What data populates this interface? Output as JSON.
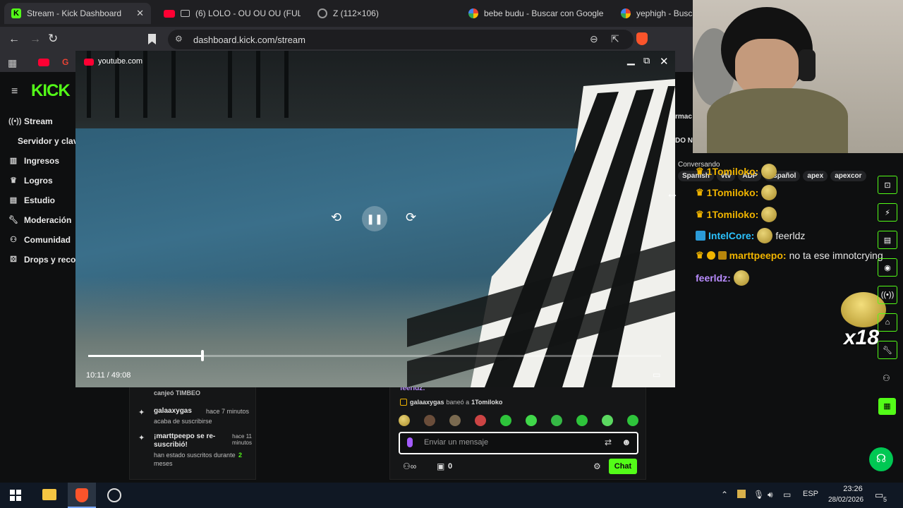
{
  "tabs": [
    {
      "label": "Stream - Kick Dashboard",
      "icon": "kick-logo-icon",
      "active": true
    },
    {
      "label": "(6) LOLO - OU OU OU (FULL A",
      "icon": "youtube-icon"
    },
    {
      "label": "Z (112×106)",
      "icon": "globe-icon"
    },
    {
      "label": "bebe budu - Buscar con Google",
      "icon": "google-icon"
    },
    {
      "label": "yephigh - Buscar",
      "icon": "google-icon"
    }
  ],
  "toolbar": {
    "url": "dashboard.kick.com/stream"
  },
  "pip": {
    "source": "youtube.com",
    "time": "10:11 / 49:08",
    "progress": 0.2
  },
  "sidebar": {
    "logo": "KICK",
    "items": [
      {
        "label": "Stream",
        "icon": "broadcast-icon"
      },
      {
        "label": "Servidor y clav",
        "icon": ""
      },
      {
        "label": "Ingresos",
        "icon": "chart-icon"
      },
      {
        "label": "Logros",
        "icon": "trophy-icon"
      },
      {
        "label": "Estudio",
        "icon": "studio-icon"
      },
      {
        "label": "Moderación",
        "icon": "wrench-icon"
      },
      {
        "label": "Comunidad",
        "icon": "community-icon"
      },
      {
        "label": "Drops y reco",
        "icon": "drops-icon"
      }
    ]
  },
  "right_panel": {
    "cut_text_1": "rmac",
    "cut_text_2": "DO N",
    "status": "Conversando",
    "tags": [
      "Spanish",
      "vtv",
      "ADP",
      "Español",
      "apex",
      "apexcor"
    ]
  },
  "chat": {
    "lines": [
      {
        "user": "1Tomiloko:",
        "message": "",
        "color": "#f0b400"
      },
      {
        "user": "1Tomiloko:",
        "message": "",
        "color": "#f0b400"
      },
      {
        "user": "1Tomiloko:",
        "message": "",
        "color": "#f0b400"
      },
      {
        "user": "IntelCore:",
        "message": "feerldz",
        "color": "#2cc3ff"
      },
      {
        "user": "marttpeepo:",
        "message": "no ta ese imnotcrying",
        "color": "#f0b400"
      },
      {
        "user": "feerldz:",
        "message": "",
        "color": "#b98cff"
      }
    ],
    "combo": "x18"
  },
  "activity": [
    {
      "title": "canjeó TIMBEO",
      "time": "",
      "sub": ""
    },
    {
      "title": "galaaxygas",
      "time": "hace 7 minutos",
      "sub": "acaba de suscribirse"
    },
    {
      "title": "¡marttpeepo se re-suscribió!",
      "time": "hace 11 minutos",
      "sub": "han estado suscritos durante",
      "highlight": "2",
      "sub2": "meses"
    }
  ],
  "chat_panel": {
    "top_user": "feerldz:",
    "ban_notice_user": "galaaxygas",
    "ban_notice_text": "baneó a",
    "ban_notice_target": "1Tomiloko",
    "input_placeholder": "Enviar un mensaje",
    "points": "0",
    "chat_button": "Chat"
  },
  "taskbar": {
    "language": "ESP",
    "time": "23:26",
    "date": "28/02/2026",
    "notifications": "5"
  }
}
